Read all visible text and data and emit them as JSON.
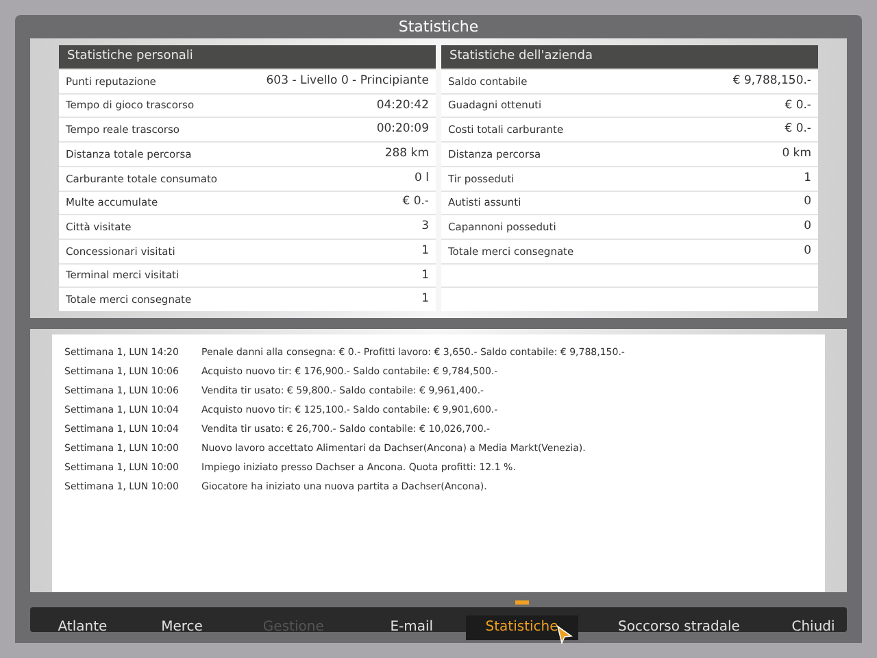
{
  "window": {
    "title": "Statistiche"
  },
  "personal": {
    "title": "Statistiche personali",
    "rows": [
      {
        "label": "Punti reputazione",
        "value": "603 - Livello 0 - Principiante"
      },
      {
        "label": "Tempo di gioco trascorso",
        "value": "04:20:42"
      },
      {
        "label": "Tempo reale trascorso",
        "value": "00:20:09"
      },
      {
        "label": "Distanza totale percorsa",
        "value": "288 km"
      },
      {
        "label": "Carburante totale consumato",
        "value": "0 l"
      },
      {
        "label": "Multe accumulate",
        "value": "€ 0.-"
      },
      {
        "label": "Città visitate",
        "value": "3"
      },
      {
        "label": "Concessionari visitati",
        "value": "1"
      },
      {
        "label": "Terminal merci visitati",
        "value": "1"
      },
      {
        "label": "Totale merci consegnate",
        "value": "1"
      }
    ]
  },
  "company": {
    "title": "Statistiche dell'azienda",
    "rows": [
      {
        "label": "Saldo contabile",
        "value": "€ 9,788,150.-"
      },
      {
        "label": "Guadagni ottenuti",
        "value": "€ 0.-"
      },
      {
        "label": "Costi totali carburante",
        "value": "€ 0.-"
      },
      {
        "label": "Distanza percorsa",
        "value": "0 km"
      },
      {
        "label": "Tir posseduti",
        "value": "1"
      },
      {
        "label": "Autisti assunti",
        "value": "0"
      },
      {
        "label": "Capannoni posseduti",
        "value": "0"
      },
      {
        "label": "Totale merci consegnate",
        "value": "0"
      }
    ]
  },
  "log": [
    {
      "time": "Settimana 1, LUN 14:20",
      "message": "Penale danni alla consegna: € 0.- Profitti lavoro: € 3,650.- Saldo contabile: € 9,788,150.-"
    },
    {
      "time": "Settimana 1, LUN 10:06",
      "message": "Acquisto nuovo tir: € 176,900.- Saldo contabile: € 9,784,500.-"
    },
    {
      "time": "Settimana 1, LUN 10:06",
      "message": "Vendita tir usato: € 59,800.- Saldo contabile: € 9,961,400.-"
    },
    {
      "time": "Settimana 1, LUN 10:04",
      "message": "Acquisto nuovo tir: € 125,100.- Saldo contabile: € 9,901,600.-"
    },
    {
      "time": "Settimana 1, LUN 10:04",
      "message": "Vendita tir usato: € 26,700.- Saldo contabile: € 10,026,700.-"
    },
    {
      "time": "Settimana 1, LUN 10:00",
      "message": "Nuovo lavoro accettato Alimentari da Dachser(Ancona) a Media Markt(Venezia)."
    },
    {
      "time": "Settimana 1, LUN 10:00",
      "message": "Impiego iniziato presso Dachser a Ancona. Quota profitti: 12.1 %."
    },
    {
      "time": "Settimana 1, LUN 10:00",
      "message": "Giocatore ha iniziato una nuova partita a Dachser(Ancona)."
    }
  ],
  "nav": [
    {
      "label": "Atlante",
      "selected": false,
      "disabled": false
    },
    {
      "label": "Merce",
      "selected": false,
      "disabled": false
    },
    {
      "label": "Gestione",
      "selected": false,
      "disabled": true
    },
    {
      "label": "E-mail",
      "selected": false,
      "disabled": false
    },
    {
      "label": "Statistiche",
      "selected": true,
      "disabled": false
    },
    {
      "label": "Soccorso stradale",
      "selected": false,
      "disabled": false
    },
    {
      "label": "Chiudi",
      "selected": false,
      "disabled": false
    }
  ]
}
